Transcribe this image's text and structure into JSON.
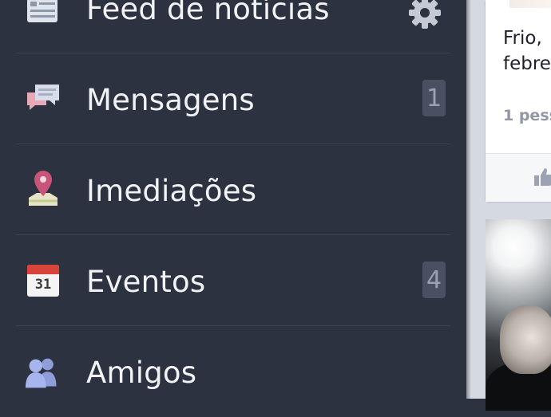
{
  "menu": {
    "items": [
      {
        "label": "Feed de notícias",
        "icon": "newspaper-icon"
      },
      {
        "label": "Mensagens",
        "icon": "chat-bubbles-icon",
        "badge": "1"
      },
      {
        "label": "Imediações",
        "icon": "map-pin-icon"
      },
      {
        "label": "Eventos",
        "icon": "calendar-icon",
        "calendar_day": "31",
        "badge": "4"
      },
      {
        "label": "Amigos",
        "icon": "friends-icon"
      }
    ],
    "settings_icon": "gear-icon"
  },
  "feed": {
    "post_text_line1": "Frio,",
    "post_text_line2": "febre",
    "likes_text": "1 pess",
    "like_icon": "thumbs-up-icon"
  },
  "colors": {
    "sidebar_bg": "#2d3240",
    "badge_bg": "#4a5061",
    "feed_bg": "#d5d9e2",
    "calendar_red": "#d8443a",
    "pin_color": "#c9547a"
  }
}
